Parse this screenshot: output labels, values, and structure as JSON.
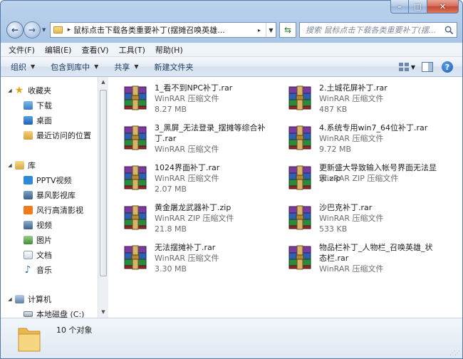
{
  "window": {
    "address_path": "鼠标点击下载各类重要补丁(摆摊召唤英雄...",
    "search_placeholder": "搜索 鼠标点击下载各类重要补丁(摆..."
  },
  "menu": [
    "文件(F)",
    "编辑(E)",
    "查看(V)",
    "工具(T)",
    "帮助(H)"
  ],
  "commands": {
    "organize": "组织",
    "include_library": "包含到库中",
    "share": "共享",
    "new_folder": "新建文件夹"
  },
  "nav": {
    "favorites": {
      "label": "收藏夹",
      "items": [
        "下载",
        "桌面",
        "最近访问的位置"
      ]
    },
    "libraries": {
      "label": "库",
      "items": [
        "PPTV视频",
        "暴风影视库",
        "风行高清影视",
        "视频",
        "图片",
        "文档",
        "音乐"
      ]
    },
    "computer": {
      "label": "计算机",
      "items": [
        "本地磁盘 (C:)"
      ]
    }
  },
  "files": [
    {
      "name": "1_看不到NPC补丁.rar",
      "type": "WinRAR 压缩文件",
      "size": "8.27 MB"
    },
    {
      "name": "2.土城花屏补丁.rar",
      "type": "WinRAR 压缩文件",
      "size": "487 KB"
    },
    {
      "name": "3_黑屏_无法登录_摆摊等综合补丁.rar",
      "type": "WinRAR 压缩文件",
      "size": ""
    },
    {
      "name": "4.系统专用win7_64位补丁.rar",
      "type": "WinRAR 压缩文件",
      "size": "9.72 MB"
    },
    {
      "name": "1024界面补丁.rar",
      "type": "WinRAR 压缩文件",
      "size": "2.07 MB"
    },
    {
      "name": "更新盛大导致输入帐号界面无法显示.zip",
      "type": "WinRAR ZIP 压缩文件",
      "size": ""
    },
    {
      "name": "黄金屠龙武器补丁.zip",
      "type": "WinRAR ZIP 压缩文件",
      "size": "21.8 MB"
    },
    {
      "name": "沙巴克补丁.rar",
      "type": "WinRAR 压缩文件",
      "size": "533 KB"
    },
    {
      "name": "无法摆摊补丁.rar",
      "type": "WinRAR 压缩文件",
      "size": "3.30 MB"
    },
    {
      "name": "物品栏补丁_人物栏_召唤英雄_状态栏.rar",
      "type": "WinRAR 压缩文件",
      "size": ""
    }
  ],
  "status": {
    "count_text": "10 个对象"
  },
  "colors": {
    "accent": "#1d5cb0",
    "folder": "#e8b94a",
    "winrar_purple": "#6a2c8c"
  }
}
